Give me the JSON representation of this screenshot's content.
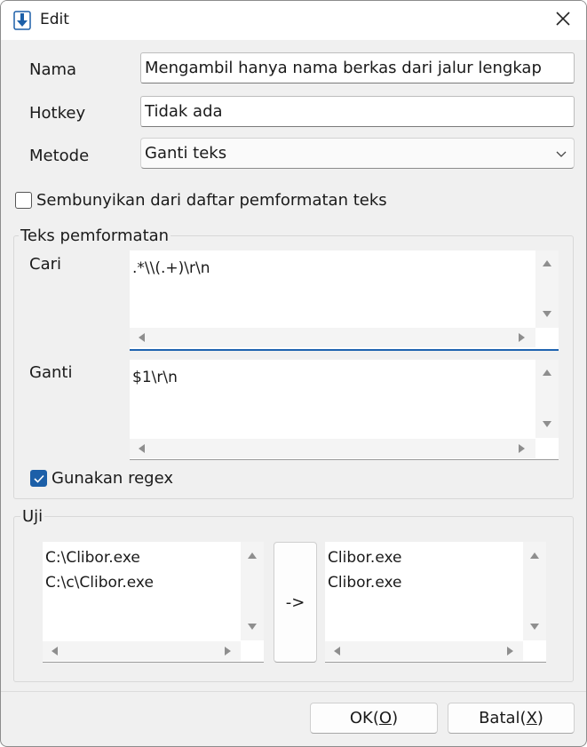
{
  "window": {
    "title": "Edit"
  },
  "fields": {
    "nama_label": "Nama",
    "nama_value": "Mengambil hanya nama berkas dari jalur lengkap",
    "hotkey_label": "Hotkey",
    "hotkey_value": "Tidak ada",
    "metode_label": "Metode",
    "metode_value": "Ganti teks"
  },
  "hide_checkbox": {
    "label": "Sembunyikan dari daftar pemformatan teks",
    "checked": false
  },
  "format_group": {
    "title": "Teks pemformatan",
    "cari_label": "Cari",
    "cari_value": ".*\\\\(.+)\\r\\n",
    "ganti_label": "Ganti",
    "ganti_value": "$1\\r\\n",
    "regex_label": "Gunakan regex",
    "regex_checked": true
  },
  "test_group": {
    "title": "Uji",
    "input_lines": "C:\\Clibor.exe\nC:\\c\\Clibor.exe",
    "run_label": "->",
    "output_lines": "Clibor.exe\nClibor.exe"
  },
  "footer": {
    "ok_label": "OK(",
    "ok_key": "O",
    "ok_tail": ")",
    "cancel_label": "Batal(",
    "cancel_key": "X",
    "cancel_tail": ")"
  },
  "icons": {
    "app": "download-arrow-icon",
    "close": "close-icon",
    "combo": "chevron-down-icon"
  },
  "colors": {
    "accent": "#1c5fa8",
    "focus": "#1f63b0"
  }
}
